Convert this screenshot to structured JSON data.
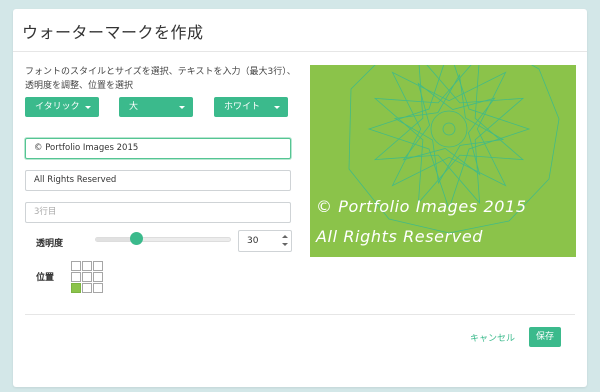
{
  "dialog": {
    "title": "ウォーターマークを作成",
    "description": "フォントのスタイルとサイズを選択、テキストを入力（最大3行）、透明度を調整、位置を選択"
  },
  "dropdowns": {
    "style": "イタリック",
    "size": "大",
    "color": "ホワイト"
  },
  "inputs": {
    "line1_value": "© Portfolio Images 2015",
    "line2_value": "All Rights Reserved",
    "line3_placeholder": "3行目"
  },
  "opacity": {
    "label": "透明度",
    "value": "30"
  },
  "position": {
    "label": "位置",
    "selected": "bottom-left"
  },
  "preview": {
    "line1": "© Portfolio Images 2015",
    "line2": "All Rights Reserved",
    "background_color": "#8bc34a",
    "pattern_color": "#3bba8c"
  },
  "footer": {
    "cancel_label": "キャンセル",
    "save_label": "保存"
  },
  "accent_color": "#3bba8c"
}
